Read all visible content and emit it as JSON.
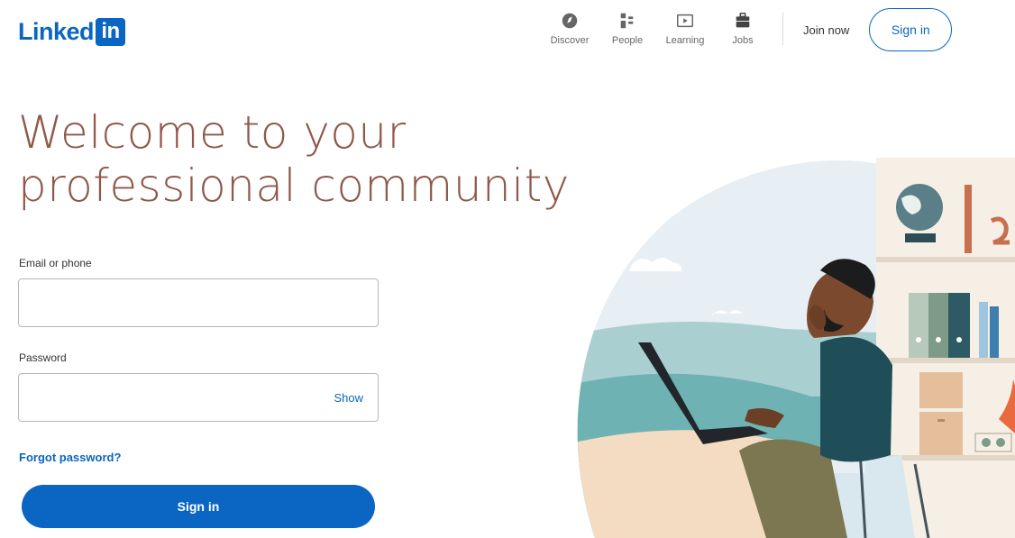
{
  "brand": {
    "name": "Linked",
    "badge": "in"
  },
  "nav": {
    "items": [
      {
        "label": "Discover",
        "icon": "compass-icon"
      },
      {
        "label": "People",
        "icon": "people-icon"
      },
      {
        "label": "Learning",
        "icon": "learning-icon"
      },
      {
        "label": "Jobs",
        "icon": "briefcase-icon"
      }
    ],
    "join_now": "Join now",
    "sign_in": "Sign in"
  },
  "hero": {
    "line1": "Welcome to your",
    "line2": "professional community"
  },
  "form": {
    "email_label": "Email or phone",
    "email_value": "",
    "password_label": "Password",
    "password_value": "",
    "show_label": "Show",
    "forgot_label": "Forgot password?",
    "submit_label": "Sign in"
  },
  "colors": {
    "accent": "#0a66c2",
    "headline": "#8f5849"
  }
}
